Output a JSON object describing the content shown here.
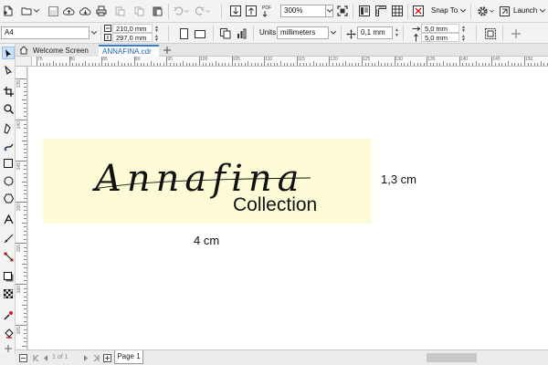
{
  "toolbar": {
    "zoom": "300%",
    "snap_to": "Snap To",
    "launch": "Launch"
  },
  "propertybar": {
    "page_size": "A4",
    "width": "210,0 mm",
    "height": "297,0 mm",
    "units_label": "Units:",
    "units": "millimeters",
    "nudge": "0,1 mm",
    "dup_x": "5,0 mm",
    "dup_y": "5,0 mm"
  },
  "tabs": [
    {
      "label": "Welcome Screen"
    },
    {
      "label": "ANNAFINA.cdr"
    }
  ],
  "ruler": {
    "h_ticks": [
      "75",
      "80",
      "85",
      "90",
      "95",
      "100",
      "105",
      "110",
      "115",
      "120",
      "125",
      "130",
      "135",
      "140",
      "145",
      "150"
    ],
    "v_ticks": [
      "135",
      "140",
      "145",
      "150",
      "155",
      "160",
      "165"
    ]
  },
  "artwork": {
    "script_text": "Annafina",
    "sub_text": "Collection",
    "dim_width": "4 cm",
    "dim_height": "1,3 cm",
    "bg_color": "#fefcd6"
  },
  "status": {
    "page_counter": "1  of  1",
    "page_tab": "Page 1"
  }
}
